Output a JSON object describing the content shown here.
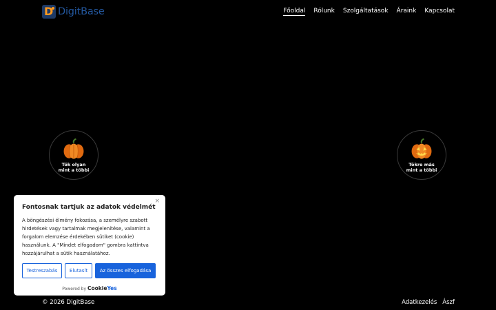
{
  "header": {
    "logo_letter": "D",
    "logo_text": "DigitBase",
    "nav": [
      {
        "label": "Főoldal",
        "active": true
      },
      {
        "label": "Rólunk"
      },
      {
        "label": "Szolgáltatások"
      },
      {
        "label": "Áraink"
      },
      {
        "label": "Kapcsolat"
      }
    ]
  },
  "badges": {
    "left": {
      "label": "Tök olyan\nmint a többi",
      "icon": "pumpkin-icon"
    },
    "right": {
      "label": "Tökre más\nmint a többi",
      "icon": "jack-o-lantern-icon"
    }
  },
  "cookie": {
    "close": "×",
    "title": "Fontosnak tartjuk az adatok védelmét",
    "text": "A böngészési élmény fokozása, a személyre szabott hirdetések vagy tartalmak megjelenítése, valamint a forgalom elemzése érdekében sütiket (cookie) használunk. A \"Mindet elfogadom\" gombra kattintva hozzájárulhat a sütik használatához.",
    "buttons": {
      "customize": "Testreszabás",
      "reject": "Elutasít",
      "accept": "Az összes elfogadása"
    },
    "powered_by": "Powered by",
    "brand_a": "Cookie",
    "brand_b": "Yes"
  },
  "footer": {
    "copyright": "© 2026 DigitBase",
    "links": [
      "Adatkezelés",
      "Ászf"
    ]
  },
  "colors": {
    "accent": "#1863dc",
    "logo_orange": "#ff9a1f",
    "logo_blue": "#23579e"
  }
}
